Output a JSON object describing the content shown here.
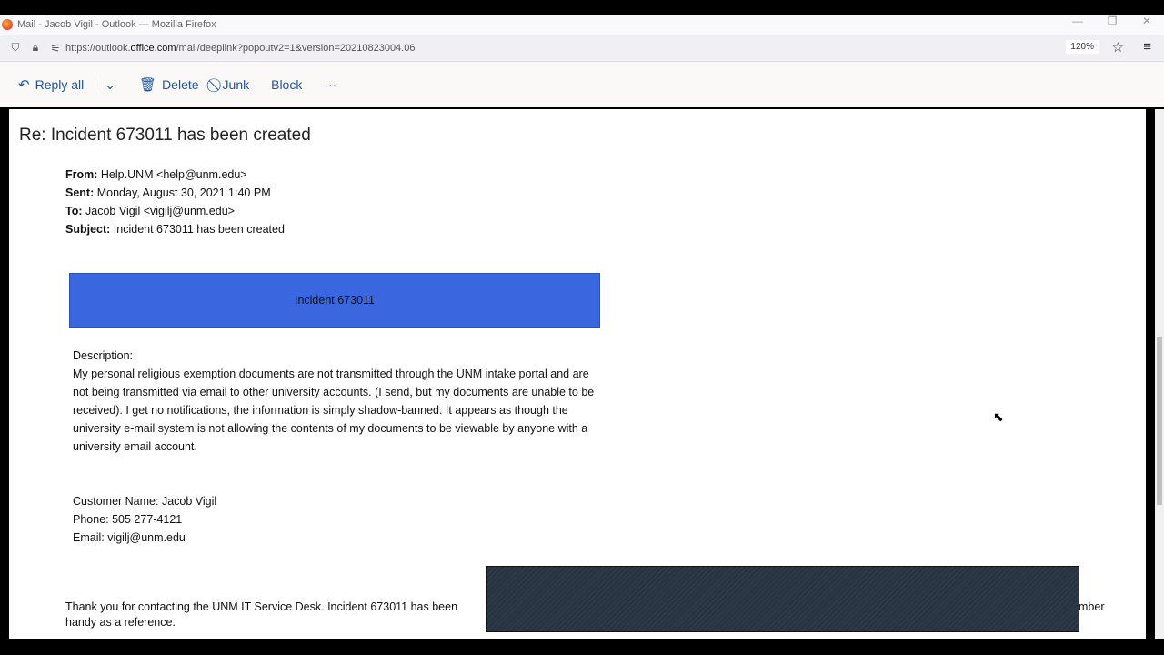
{
  "window": {
    "title": "Mail - Jacob Vigil - Outlook — Mozilla Firefox",
    "minimize": "—",
    "restore": "❐",
    "close": "✕"
  },
  "browser": {
    "url_prefix": "https://outlook.",
    "url_domain": "office.com",
    "url_suffix": "/mail/deeplink?popoutv2=1&version=20210823004.06",
    "zoom": "120%"
  },
  "toolbar": {
    "reply_all": "Reply all",
    "delete": "Delete",
    "junk": "Junk",
    "block": "Block",
    "more": "···"
  },
  "email": {
    "subject": "Re: Incident 673011 has been created",
    "from_label": "From:",
    "from": "Help.UNM <help@unm.edu>",
    "sent_label": "Sent:",
    "sent": "Monday, August 30, 2021 1:40 PM",
    "to_label": "To:",
    "to": "Jacob Vigil <vigilj@unm.edu>",
    "subject_label": "Subject:",
    "subject_line": "Incident 673011 has been created",
    "banner": "Incident 673011",
    "description_label": "Description:",
    "description": "My personal religious exemption documents are not transmitted through the UNM intake portal and are not being transmitted via email to other university accounts. (I send, but my documents are unable to be received). I get no notifications, the information is simply shadow-banned. It appears as though the university e-mail system is not allowing the contents of my documents to be viewable by anyone with a university email account.",
    "customer_name": "Customer Name:  Jacob Vigil",
    "phone": "Phone:  505 277-4121",
    "email": "Email:  vigilj@unm.edu",
    "footer_start": "Thank you for contacting the UNM IT Service Desk. Incident 673011 has been",
    "footer_end": "mber",
    "footer_line2": "handy as a reference."
  },
  "colors": {
    "banner": "#3a67e0",
    "accent": "#1b55a8"
  }
}
